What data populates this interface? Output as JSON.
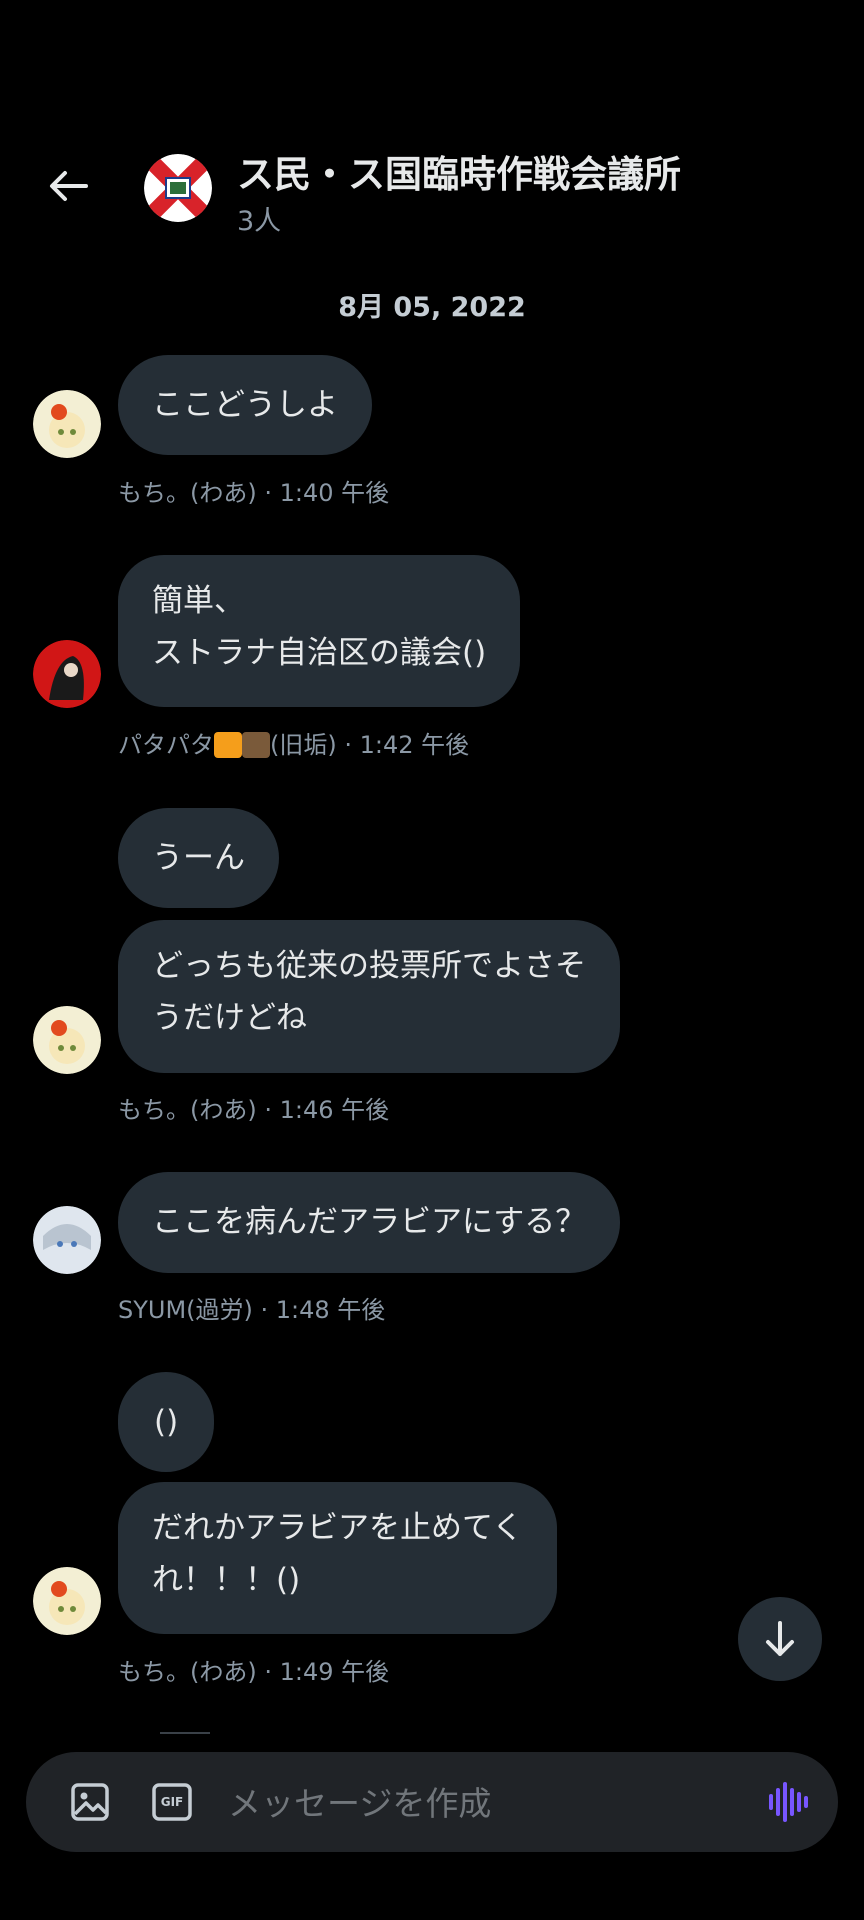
{
  "header": {
    "back_label": "",
    "title": "ス民・ス国臨時作戦会議所",
    "members": "3人"
  },
  "date_separator": "8月 05, 2022",
  "messages": [
    {
      "text": "ここどうしよ"
    },
    {
      "meta": "もち。(わあ) · 1:40 午後"
    },
    {
      "lines": [
        "簡単、",
        "ストラナ自治区の議会()"
      ]
    },
    {
      "meta_name": "パタパタ",
      "meta_name_suffix": "(旧垢) · 1:42 午後"
    },
    {
      "text": "うーん"
    },
    {
      "lines": [
        "どっちも従来の投票所でよさそ",
        "うだけどね"
      ]
    },
    {
      "meta": "もち。(わあ) · 1:46 午後"
    },
    {
      "text": "ここを病んだアラビアにする？"
    },
    {
      "meta": "SYUM(過労) · 1:48 午後"
    },
    {
      "text": "()"
    },
    {
      "lines": [
        "だれかアラビアを止めてく",
        "れ！！！()"
      ]
    },
    {
      "meta": "もち。(わあ) · 1:49 午後"
    }
  ],
  "composer": {
    "placeholder": "メッセージを作成",
    "gif_label": "GIF"
  },
  "colors": {
    "background": "#000000",
    "bubble": "#252e36",
    "meta_text": "#8b98a5",
    "voice_accent": "#7856ff"
  },
  "icons": [
    "back-arrow-icon",
    "image-icon",
    "gif-icon",
    "voice-wave-icon",
    "arrow-down-icon"
  ]
}
